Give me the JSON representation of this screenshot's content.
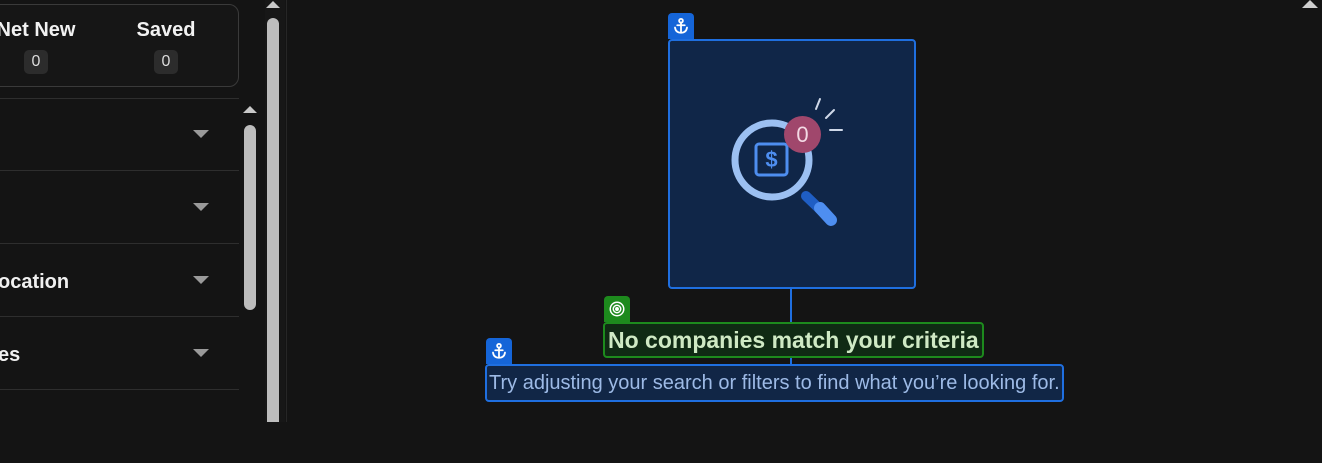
{
  "counts": {
    "net_new": {
      "label": "Net New",
      "value": "0"
    },
    "saved": {
      "label": "Saved",
      "value": "0"
    }
  },
  "filters": [
    {
      "label": ""
    },
    {
      "label": ""
    },
    {
      "label": "ocation"
    },
    {
      "label": "es"
    },
    {
      "label": ""
    }
  ],
  "empty_state": {
    "badge_count": "0",
    "title": "No companies match your criteria",
    "description": "Try adjusting your search or filters to find what you’re looking for."
  },
  "colors": {
    "accent_blue": "#1f6fe0",
    "success_green": "#1d8a1d",
    "badge_magenta": "#a0476c"
  }
}
